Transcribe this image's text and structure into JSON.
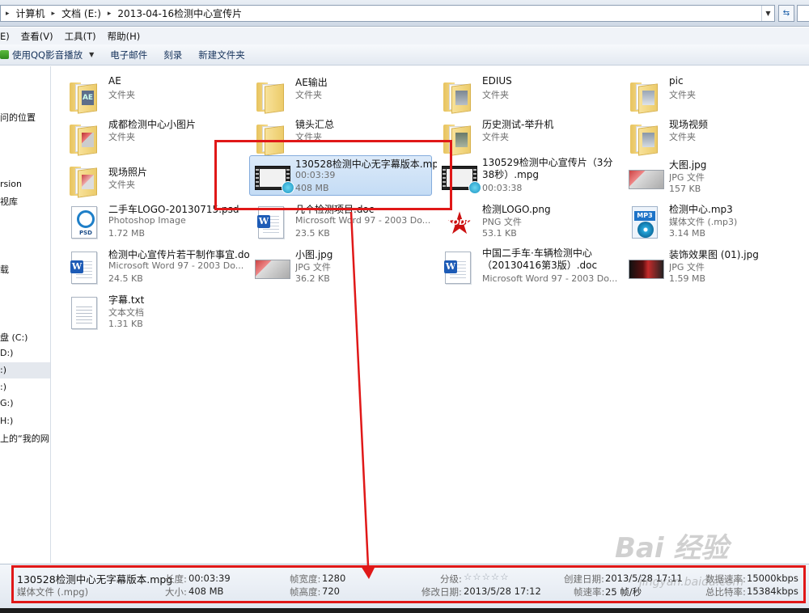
{
  "address": {
    "crumbs": [
      "计算机",
      "文档 (E:)",
      "2013-04-16检测中心宣传片"
    ],
    "refresh_glyph": "↻"
  },
  "menu": [
    "E)",
    "查看(V)",
    "工具(T)",
    "帮助(H)"
  ],
  "toolbar": {
    "play_label": "使用QQ影音播放",
    "email_label": "电子邮件",
    "burn_label": "刻录",
    "new_folder_label": "新建文件夹"
  },
  "nav": [
    "问的位置",
    "rsion",
    "视库",
    "载",
    "盘 (C:)",
    "D:)",
    ":)",
    ":)",
    "G:)",
    "H:)",
    "上的“我的网"
  ],
  "files": [
    {
      "name": "AE",
      "type": "文件夹",
      "size": ""
    },
    {
      "name": "AE输出",
      "type": "文件夹",
      "size": ""
    },
    {
      "name": "EDIUS",
      "type": "文件夹",
      "size": ""
    },
    {
      "name": "pic",
      "type": "文件夹",
      "size": ""
    },
    {
      "name": "成都检测中心小图片",
      "type": "文件夹",
      "size": ""
    },
    {
      "name": "镜头汇总",
      "type": "文件夹",
      "size": ""
    },
    {
      "name": "历史测试-举升机",
      "type": "文件夹",
      "size": ""
    },
    {
      "name": "现场视频",
      "type": "文件夹",
      "size": ""
    },
    {
      "name": "现场照片",
      "type": "文件夹",
      "size": ""
    },
    {
      "name": "130528检测中心无字幕版本.mpg",
      "type": "00:03:39",
      "size": "408 MB"
    },
    {
      "name": "130529检测中心宣传片（3分38秒）.mpg",
      "type": "00:03:38",
      "size": ""
    },
    {
      "name": "大图.jpg",
      "type": "JPG 文件",
      "size": "157 KB"
    },
    {
      "name": "二手车LOGO-20130715.psd",
      "type": "Photoshop Image",
      "size": "1.72 MB"
    },
    {
      "name": "几个检测项目.doc",
      "type": "Microsoft Word 97 - 2003 Do...",
      "size": "23.5 KB"
    },
    {
      "name": "检测LOGO.png",
      "type": "PNG 文件",
      "size": "53.1 KB"
    },
    {
      "name": "检测中心.mp3",
      "type": "媒体文件 (.mp3)",
      "size": "3.14 MB"
    },
    {
      "name": "检测中心宣传片若干制作事宜.doc",
      "type": "Microsoft Word 97 - 2003 Do...",
      "size": "24.5 KB"
    },
    {
      "name": "小图.jpg",
      "type": "JPG 文件",
      "size": "36.2 KB"
    },
    {
      "name": "中国二手车·车辆检测中心（20130416第3版）.doc",
      "type": "Microsoft Word 97 - 2003 Do...",
      "size": ""
    },
    {
      "name": "装饰效果图 (01).jpg",
      "type": "JPG 文件",
      "size": "1.59 MB"
    },
    {
      "name": "字幕.txt",
      "type": "文本文档",
      "size": "1.31 KB"
    }
  ],
  "icons": {
    "thumb_ae_text": "AE",
    "word_badge": "W",
    "psd_text": "PSD",
    "mp3_label": "MP3",
    "star_glyph": "★",
    "star_text": "TODO"
  },
  "details": {
    "filename": "130528检测中心无字幕版本.mpg",
    "filetype": "媒体文件 (.mpg)",
    "length_label": "长度:",
    "length_value": "00:03:39",
    "size_label": "大小:",
    "size_value": "408 MB",
    "frame_width_label": "帧宽度:",
    "frame_width_value": "1280",
    "frame_height_label": "帧高度:",
    "frame_height_value": "720",
    "rating_label": "分级:",
    "rating_stars": "☆☆☆☆☆",
    "modified_label": "修改日期:",
    "modified_value": "2013/5/28 17:12",
    "created_label": "创建日期:",
    "created_value": "2013/5/28 17:11",
    "framerate_label": "帧速率:",
    "framerate_value": "25 帧/秒",
    "datarate_label": "数据速率:",
    "datarate_value": "15000kbps",
    "totalbitrate_label": "总比特率:",
    "totalbitrate_value": "15384kbps"
  },
  "watermark": {
    "brand": "Bai 经验",
    "url": "jingyan.baidu.com"
  },
  "colors": {
    "annotation_red": "#e01818",
    "selection_blue": "#c4dcf5"
  }
}
